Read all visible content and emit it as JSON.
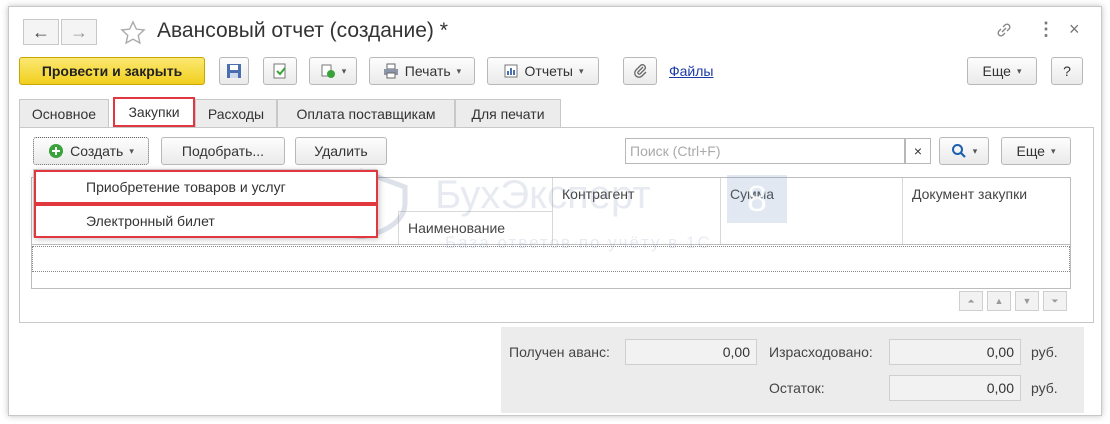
{
  "window": {
    "title": "Авансовый отчет (создание) *",
    "nav": {
      "back": "←",
      "forward": "→"
    },
    "icons": {
      "favorite": "star-outline-icon",
      "link": "link-icon",
      "more": "kebab-menu-icon",
      "close": "close-icon"
    }
  },
  "toolbar": {
    "post_close": "Провести и закрыть",
    "print": "Печать",
    "reports": "Отчеты",
    "files": "Файлы",
    "more": "Еще",
    "help": "?"
  },
  "tabs": [
    {
      "label": "Основное"
    },
    {
      "label": "Закупки"
    },
    {
      "label": "Расходы"
    },
    {
      "label": "Оплата поставщикам"
    },
    {
      "label": "Для печати"
    }
  ],
  "purchases": {
    "create": "Создать",
    "pick": "Подобрать...",
    "delete": "Удалить",
    "search_placeholder": "Поиск (Ctrl+F)",
    "search_clear": "×",
    "more": "Еще",
    "columns": {
      "name": "Наименование",
      "counterparty": "Контрагент",
      "amount": "Сумма",
      "purchase_doc": "Документ закупки"
    },
    "create_menu": [
      {
        "label": "Приобретение товаров и услуг"
      },
      {
        "label": "Электронный билет"
      }
    ]
  },
  "totals": {
    "advance_label": "Получен аванс:",
    "advance_value": "0,00",
    "spent_label": "Израсходовано:",
    "spent_value": "0,00",
    "rest_label": "Остаток:",
    "rest_value": "0,00",
    "currency": "руб."
  },
  "watermark": {
    "brand": "БухЭксперт",
    "brand_suffix": "8",
    "tagline": "База ответов по учёту в 1С"
  },
  "colors": {
    "accent_yellow": "#f1cf1e",
    "highlight_red": "#e0383e",
    "link_blue": "#1c3aa8"
  }
}
